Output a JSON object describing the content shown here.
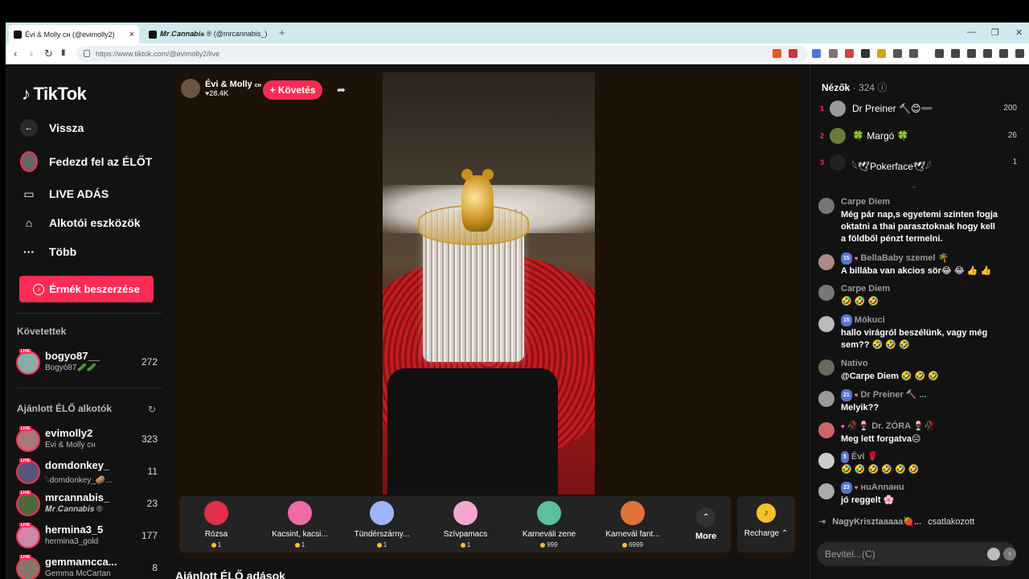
{
  "browser": {
    "tabs": [
      {
        "title": "Évi & Molly ᴄʜ (@evimolly2)",
        "close": "×"
      },
      {
        "title": "𝑴𝒓.𝑪𝒂𝒏𝒏𝒂𝒃𝒊𝒔 ® (@mrcannabis_)"
      }
    ],
    "new_tab": "+",
    "url": "https://www.tiktok.com/@evimolly2/live",
    "window_controls": [
      "—",
      "❐",
      "✕"
    ]
  },
  "sidebar": {
    "logo": "TikTok",
    "back": "Vissza",
    "explore": "Fedezd fel az ÉLŐT",
    "live": "LIVE ADÁS",
    "creator_tools": "Alkotói eszközök",
    "more": "Több",
    "coins_button": "Érmék beszerzése",
    "following_title": "Követettek",
    "following": [
      {
        "name": "bogyo87__",
        "sub": "Bogyó87🥒🥒",
        "count": "272"
      }
    ],
    "recommended_title": "Ajánlott ÉLŐ alkotók",
    "recommended": [
      {
        "name": "evimolly2",
        "sub": "Évi & Molly ᴄʜ",
        "count": "323"
      },
      {
        "name": "domdonkey_",
        "sub": "𓆩domdonkey_🥔...",
        "count": "11"
      },
      {
        "name": "mrcannabis_",
        "sub": "𝑴𝒓.𝑪𝒂𝒏𝒏𝒂𝒃𝒊𝒔 ®",
        "count": "23"
      },
      {
        "name": "hermina3_5",
        "sub": "hermina3_gold",
        "count": "177"
      },
      {
        "name": "gemmamcca...",
        "sub": "Gemma McCartan",
        "count": "8"
      }
    ],
    "live_badge": "LIVE"
  },
  "stream": {
    "host_name": "Évi & Molly",
    "host_suffix": "ᴄʜ",
    "likes": "♥28.4K",
    "follow_button": "+ Követés",
    "gifts": [
      {
        "name": "Rózsa",
        "price": "1",
        "color": "#e0304a"
      },
      {
        "name": "Kacsint, kacsi...",
        "price": "1",
        "color": "#f06aa8"
      },
      {
        "name": "Tündérszárny...",
        "price": "1",
        "color": "#9fb4ff"
      },
      {
        "name": "Szívpamacs",
        "price": "1",
        "color": "#f7a6cf"
      },
      {
        "name": "Karneváli zene",
        "price": "999",
        "color": "#5cc0a0"
      },
      {
        "name": "Karnevál fant...",
        "price": "6999",
        "color": "#e0733a"
      }
    ],
    "more_label": "More",
    "recharge_label": "Recharge ⌃"
  },
  "bottom_section_title": "Ajánlott ÉLŐ adások",
  "viewers": {
    "title": "Nézők",
    "count": "· 324",
    "top": [
      {
        "rank": "1",
        "name": "Dr Preiner 🔨😊➖",
        "points": "200"
      },
      {
        "rank": "2",
        "name": "🍀 Margó 🍀",
        "points": "26"
      },
      {
        "rank": "3",
        "name": "𓆩🕊Pokerface🕊𓆪",
        "points": "1"
      }
    ],
    "chevron": "⌄"
  },
  "chat": [
    {
      "user": "Carpe Diem",
      "badges": "",
      "text": "Még pár nap,s egyetemi szinten fogja oktatni a thai parasztoknak hogy kell a földből pénzt termelni."
    },
    {
      "user": "BellaBaby szemel 🌴",
      "badges": "15",
      "text": "A billába van akcios sör😂 😂 👍 👍"
    },
    {
      "user": "Carpe Diem",
      "badges": "",
      "text": "🤣 🤣 🤣"
    },
    {
      "user": "Mókuci",
      "badges": "15",
      "text": "hallo virágról beszélünk, vagy még sem?? 🤣 🤣 🤣"
    },
    {
      "user": "Nativo",
      "badges": "",
      "text": "@Carpe Diem 🤣 🤣 🤣"
    },
    {
      "user": "Dr Preiner 🔨 ...",
      "badges": "21",
      "text": "Melyik??"
    },
    {
      "user": "🥀🍷 Dr. ZÓRA 🍷🥀",
      "badges": "",
      "text": "Meg lett forgatva😑"
    },
    {
      "user": "Évi 🌹",
      "badges": "5",
      "text": "🤣 🤣 🤣 🤣 🤣 🤣"
    },
    {
      "user": "нuAnnaнu",
      "badges": "23",
      "text": "jó reggelt 🌸"
    }
  ],
  "join": {
    "user": "NagyKrisztaaaaa🍓...",
    "text": "csatlakozott"
  },
  "chat_input_placeholder": "Bevitel...(C)"
}
